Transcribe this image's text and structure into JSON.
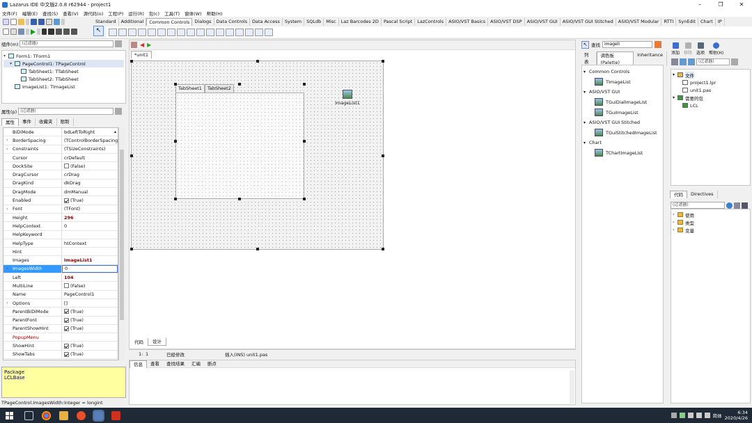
{
  "window": {
    "title": "Lazarus IDE 中文版2.0.8 r62944 - project1",
    "min": "–",
    "max": "❐",
    "close": "✕"
  },
  "menu": [
    "文件(F)",
    "编辑(E)",
    "查找(S)",
    "查看(V)",
    "源代码(o)",
    "工程(P)",
    "运行(R)",
    "包(c)",
    "工具(T)",
    "窗体(W)",
    "帮助(H)"
  ],
  "palette_tabs": [
    "Standard",
    "Additional",
    "Common Controls",
    "Dialogs",
    "Data Controls",
    "Data Access",
    "System",
    "SQLdb",
    "Misc",
    "Laz Barcodes 2D",
    "Pascal Script",
    "LazControls",
    "ASIO/VST Basics",
    "ASIO/VST DSP",
    "ASIO/VST GUI",
    "ASIO/VST GUI Stitched",
    "ASIO/VST Modular",
    "RTTI",
    "SynEdit",
    "Chart",
    "IP"
  ],
  "palette_active": "Common Controls",
  "components": {
    "label": "组件(m)",
    "filter_placeholder": "(过滤器)",
    "tree": [
      {
        "label": "Form1: TForm1",
        "level": 0,
        "expander": "▾"
      },
      {
        "label": "PageControl1: TPageControl",
        "level": 1,
        "expander": "▾",
        "selected": true
      },
      {
        "label": "TabSheet1: TTabSheet",
        "level": 2,
        "expander": ""
      },
      {
        "label": "TabSheet2: TTabSheet",
        "level": 2,
        "expander": ""
      },
      {
        "label": "ImageList1: TImageList",
        "level": 1,
        "expander": ""
      }
    ]
  },
  "inspector": {
    "label": "属性(p)",
    "filter_placeholder": "(过滤器)",
    "tabs": [
      "属性",
      "事件",
      "收藏夹",
      "限制"
    ],
    "active_tab": "属性",
    "rows": [
      {
        "name": "BiDiMode",
        "value": "bdLeftToRight",
        "exp": "",
        "dropdown": true
      },
      {
        "name": "BorderSpacing",
        "value": "(TControlBorderSpacing)",
        "exp": "›"
      },
      {
        "name": "Constraints",
        "value": "(TSizeConstraints)",
        "exp": "›"
      },
      {
        "name": "Cursor",
        "value": "crDefault",
        "exp": ""
      },
      {
        "name": "DockSite",
        "value": "(False)",
        "exp": "",
        "check": false
      },
      {
        "name": "DragCursor",
        "value": "crDrag",
        "exp": ""
      },
      {
        "name": "DragKind",
        "value": "dkDrag",
        "exp": ""
      },
      {
        "name": "DragMode",
        "value": "dmManual",
        "exp": ""
      },
      {
        "name": "Enabled",
        "value": "(True)",
        "exp": "",
        "check": true
      },
      {
        "name": "Font",
        "value": "(TFont)",
        "exp": "›"
      },
      {
        "name": "Height",
        "value": "296",
        "exp": "",
        "emph": true
      },
      {
        "name": "HelpContext",
        "value": "0",
        "exp": ""
      },
      {
        "name": "HelpKeyword",
        "value": "",
        "exp": ""
      },
      {
        "name": "HelpType",
        "value": "htContext",
        "exp": ""
      },
      {
        "name": "Hint",
        "value": "",
        "exp": ""
      },
      {
        "name": "Images",
        "value": "ImageList1",
        "exp": "",
        "emph": true
      },
      {
        "name": "ImagesWidth",
        "value": "0",
        "exp": "•",
        "editing": true
      },
      {
        "name": "Left",
        "value": "104",
        "exp": "",
        "emph": true
      },
      {
        "name": "MultiLine",
        "value": "(False)",
        "exp": "",
        "check": false
      },
      {
        "name": "Name",
        "value": "PageControl1",
        "exp": ""
      },
      {
        "name": "Options",
        "value": "[]",
        "exp": "›"
      },
      {
        "name": "ParentBiDiMode",
        "value": "(True)",
        "exp": "",
        "check": true
      },
      {
        "name": "ParentFont",
        "value": "(True)",
        "exp": "",
        "check": true
      },
      {
        "name": "ParentShowHint",
        "value": "(True)",
        "exp": "",
        "check": true
      },
      {
        "name": "PopupMenu",
        "value": "",
        "exp": "",
        "emphname": true
      },
      {
        "name": "ShowHint",
        "value": "(True)",
        "exp": "",
        "check": true
      },
      {
        "name": "ShowTabs",
        "value": "(True)",
        "exp": "",
        "check": true
      }
    ],
    "info_title": "Package",
    "info_value": "LCLBase"
  },
  "status_prop": "TPageControl.ImagesWidth:Integer = longint",
  "editor": {
    "tab": "*unit1",
    "tabsheets": [
      "TabSheet1",
      "TabSheet2"
    ],
    "imagelist_label": "ImageList1",
    "bottom_tabs": [
      "代码",
      "设计"
    ],
    "status": {
      "pos_line": "1:",
      "pos_col": "1",
      "modified": "已经修改",
      "mode": "插入(INS) unit1.pas"
    },
    "msg_tabs": [
      "信息",
      "查看",
      "查找结果",
      "汇编",
      "断点"
    ]
  },
  "palette_search": {
    "find_label": "查找",
    "query": "imageli",
    "tabs": [
      "列表",
      "调色板(Palette)",
      "Inheritance"
    ],
    "active_tab": "调色板(Palette)",
    "groups": [
      {
        "name": "Common Controls",
        "items": [
          "TImageList"
        ]
      },
      {
        "name": "ASIO/VST GUI",
        "items": [
          "TGuiDialImageList",
          "TGuiImageList"
        ]
      },
      {
        "name": "ASIO/VST GUI Stitched",
        "items": [
          "TGuiStitchedImageList"
        ]
      },
      {
        "name": "Chart",
        "items": [
          "TChartImageList"
        ]
      }
    ]
  },
  "project": {
    "toolbar": [
      "添加",
      "移除",
      "选项",
      "帮助(H)"
    ],
    "filter_placeholder": "(过滤器)",
    "tree": [
      {
        "label": "文件",
        "level": 0,
        "type": "folder",
        "selected": true
      },
      {
        "label": "project1.lpr",
        "level": 1,
        "type": "file"
      },
      {
        "label": "unit1.pas",
        "level": 1,
        "type": "file"
      },
      {
        "label": "需要的包",
        "level": 0,
        "type": "pkg"
      },
      {
        "label": "LCL",
        "level": 1,
        "type": "pkg"
      }
    ]
  },
  "code_explorer": {
    "tabs": [
      "代码",
      "Directives"
    ],
    "filter_placeholder": "(过滤器)",
    "tree": [
      "使用",
      "类型",
      "变量"
    ]
  },
  "taskbar": {
    "lang": "简体",
    "time": "6:34",
    "date": "2020/4/26"
  },
  "colors": {
    "accent": "#3b6fc6",
    "selected": "#3399ff",
    "info_bg": "#ffffa0",
    "emph": "#8b0000"
  }
}
